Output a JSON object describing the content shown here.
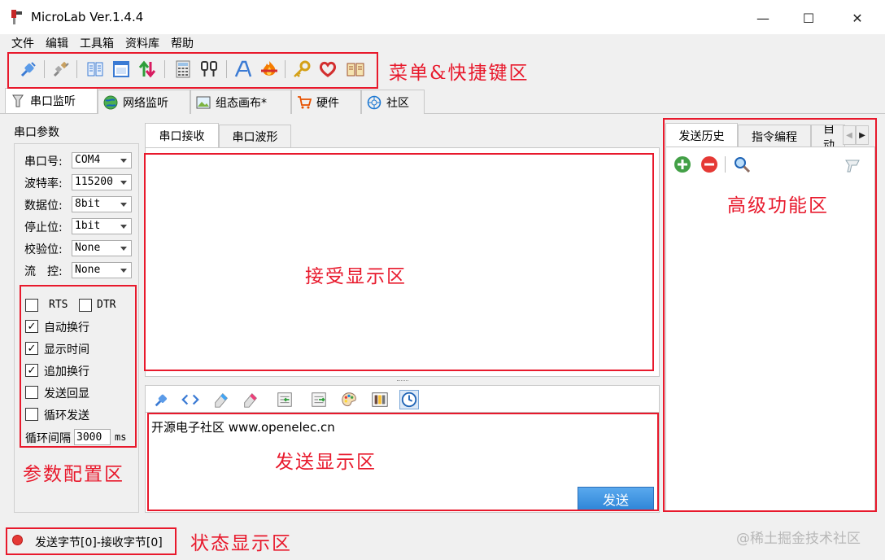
{
  "window": {
    "title": "MicroLab Ver.1.4.4",
    "minimize": "—",
    "maximize": "☐",
    "close": "✕"
  },
  "menu": [
    "文件",
    "编辑",
    "工具箱",
    "资料库",
    "帮助"
  ],
  "toolbar_icons": [
    "connect-icon",
    "disconnect-icon",
    "columns-icon",
    "window-icon",
    "up-down-arrows-icon",
    "calculator-icon",
    "usb-plug-icon",
    "font-icon",
    "flame-icon",
    "key-icon",
    "heart-icon",
    "book-icon"
  ],
  "main_tabs": [
    {
      "label": "串口监听",
      "icon": "serial-plug-icon",
      "active": true
    },
    {
      "label": "网络监听",
      "icon": "globe-icon",
      "active": false
    },
    {
      "label": "组态画布*",
      "icon": "canvas-icon",
      "active": false
    },
    {
      "label": "硬件",
      "icon": "cart-icon",
      "active": false
    },
    {
      "label": "社区",
      "icon": "community-icon",
      "active": false
    }
  ],
  "serial_params": {
    "group_title": "串口参数",
    "fields": [
      {
        "label": "串口号:",
        "value": "COM4"
      },
      {
        "label": "波特率:",
        "value": "115200"
      },
      {
        "label": "数据位:",
        "value": "8bit"
      },
      {
        "label": "停止位:",
        "value": "1bit"
      },
      {
        "label": "校验位:",
        "value": "None"
      },
      {
        "label": "流　控:",
        "value": "None"
      }
    ],
    "rts": "RTS",
    "dtr": "DTR",
    "options": [
      {
        "label": "自动换行",
        "checked": true
      },
      {
        "label": "显示时间",
        "checked": true
      },
      {
        "label": "追加换行",
        "checked": true
      },
      {
        "label": "发送回显",
        "checked": false
      },
      {
        "label": "循环发送",
        "checked": false
      }
    ],
    "loop_interval_label": "循环间隔",
    "loop_interval_value": "3000",
    "loop_interval_unit": "ms"
  },
  "center_tabs": [
    "串口接收",
    "串口波形"
  ],
  "send_box": {
    "text": "开源电子社区 www.openelec.cn",
    "send_button": "发送"
  },
  "right_panel": {
    "tabs": [
      "发送历史",
      "指令编程",
      "自动"
    ],
    "icons": [
      "add-icon",
      "remove-icon",
      "search-icon",
      "eraser-icon"
    ]
  },
  "status": {
    "text": "发送字节[0]-接收字节[0]",
    "indicator_color": "#e53935"
  },
  "annotations": {
    "menu_shortcut": "菜单&快捷键区",
    "receive_display": "接受显示区",
    "param_config": "参数配置区",
    "send_display": "发送显示区",
    "advanced": "高级功能区",
    "status_display": "状态显示区"
  },
  "watermark": "@稀土掘金技术社区"
}
